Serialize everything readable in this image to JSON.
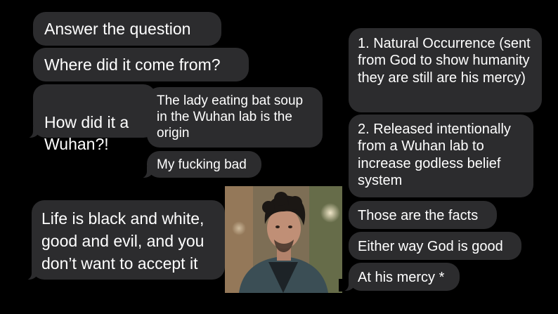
{
  "left_messages": [
    {
      "text": "Answer the question"
    },
    {
      "text": "Where did it come from?"
    },
    {
      "text": "How did it a\nWuhan?!"
    },
    {
      "text": "The lady eating bat soup in the Wuhan lab is the origin"
    },
    {
      "text": "My fucking bad"
    },
    {
      "text": "Life is black and white, good and evil, and you don’t want to accept it"
    }
  ],
  "right_messages": [
    {
      "text": "1. Natural Occurrence (sent from God to show humanity they are still are his mercy)"
    },
    {
      "text": "2. Released intentionally from a Wuhan lab to increase godless belief system"
    },
    {
      "text": "Those are the facts"
    },
    {
      "text": "Either way God is good"
    },
    {
      "text": "At his mercy *"
    }
  ],
  "colors": {
    "background": "#000000",
    "bubble": "#2c2c2e",
    "text": "#ffffff"
  }
}
